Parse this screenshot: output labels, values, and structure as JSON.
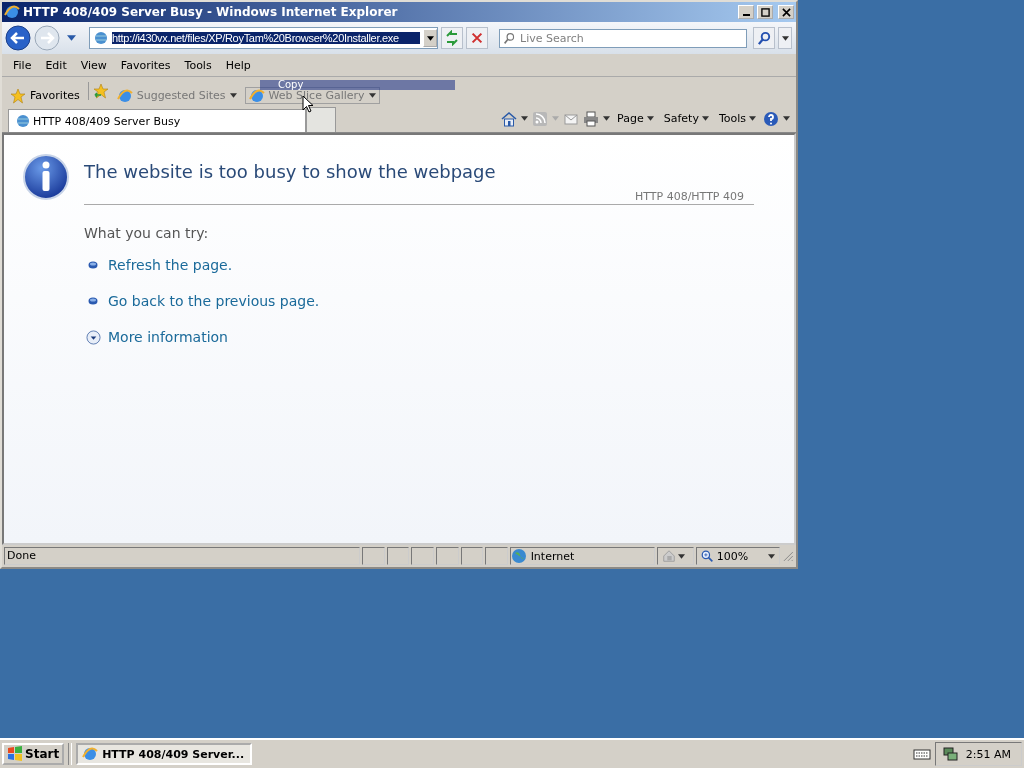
{
  "window": {
    "title": "HTTP 408/409 Server Busy - Windows Internet Explorer"
  },
  "address_bar": {
    "url": "http://i430vx.net/files/XP/RoyTam%20Browser%20Installer.exe",
    "selected": true
  },
  "search": {
    "placeholder": "Live Search"
  },
  "menu": [
    "File",
    "Edit",
    "View",
    "Favorites",
    "Tools",
    "Help"
  ],
  "favorites_bar": {
    "favorites": "Favorites",
    "links": [
      "Suggested Sites",
      "Web Slice Gallery"
    ]
  },
  "drag_tooltip": "Copy",
  "tab": {
    "title": "HTTP 408/409 Server Busy"
  },
  "command_bar": [
    "Page",
    "Safety",
    "Tools"
  ],
  "page": {
    "heading": "The website is too busy to show the webpage",
    "code": "HTTP 408/HTTP 409",
    "try_label": "What you can try:",
    "suggestions": [
      {
        "text": "Refresh the page.",
        "kind": "bullet"
      },
      {
        "text": "Go back to the previous page.",
        "kind": "bullet"
      },
      {
        "text": "More information",
        "kind": "expand"
      }
    ]
  },
  "status_bar": {
    "text": "Done",
    "zone": "Internet",
    "zoom": "100%"
  },
  "taskbar": {
    "start": "Start",
    "tasks": [
      {
        "label": "HTTP 408/409 Server...",
        "selected": true
      }
    ],
    "clock": "2:51 AM"
  }
}
